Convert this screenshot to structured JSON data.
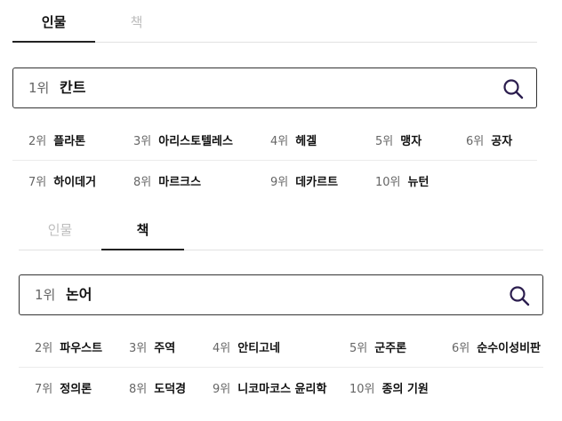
{
  "panel1": {
    "tabs": [
      {
        "label": "인물",
        "active": true
      },
      {
        "label": "책",
        "active": false
      }
    ],
    "search": {
      "rank": "1위",
      "term": "칸트"
    },
    "items": [
      {
        "rank": "2위",
        "name": "플라톤"
      },
      {
        "rank": "3위",
        "name": "아리스토텔레스"
      },
      {
        "rank": "4위",
        "name": "헤겔"
      },
      {
        "rank": "5위",
        "name": "맹자"
      },
      {
        "rank": "6위",
        "name": "공자"
      },
      {
        "rank": "7위",
        "name": "하이데거"
      },
      {
        "rank": "8위",
        "name": "마르크스"
      },
      {
        "rank": "9위",
        "name": "데카르트"
      },
      {
        "rank": "10위",
        "name": "뉴턴"
      }
    ]
  },
  "panel2": {
    "tabs": [
      {
        "label": "인물",
        "active": false
      },
      {
        "label": "책",
        "active": true
      }
    ],
    "search": {
      "rank": "1위",
      "term": "논어"
    },
    "items": [
      {
        "rank": "2위",
        "name": "파우스트"
      },
      {
        "rank": "3위",
        "name": "주역"
      },
      {
        "rank": "4위",
        "name": "안티고네"
      },
      {
        "rank": "5위",
        "name": "군주론"
      },
      {
        "rank": "6위",
        "name": "순수이성비판"
      },
      {
        "rank": "7위",
        "name": "정의론"
      },
      {
        "rank": "8위",
        "name": "도덕경"
      },
      {
        "rank": "9위",
        "name": "니코마코스 윤리학"
      },
      {
        "rank": "10위",
        "name": "종의 기원"
      }
    ]
  },
  "colors": {
    "accent": "#2b1d4e",
    "text": "#111111",
    "muted": "#bdbdbd",
    "border": "#333333"
  },
  "icons": {
    "search": "search-icon"
  }
}
